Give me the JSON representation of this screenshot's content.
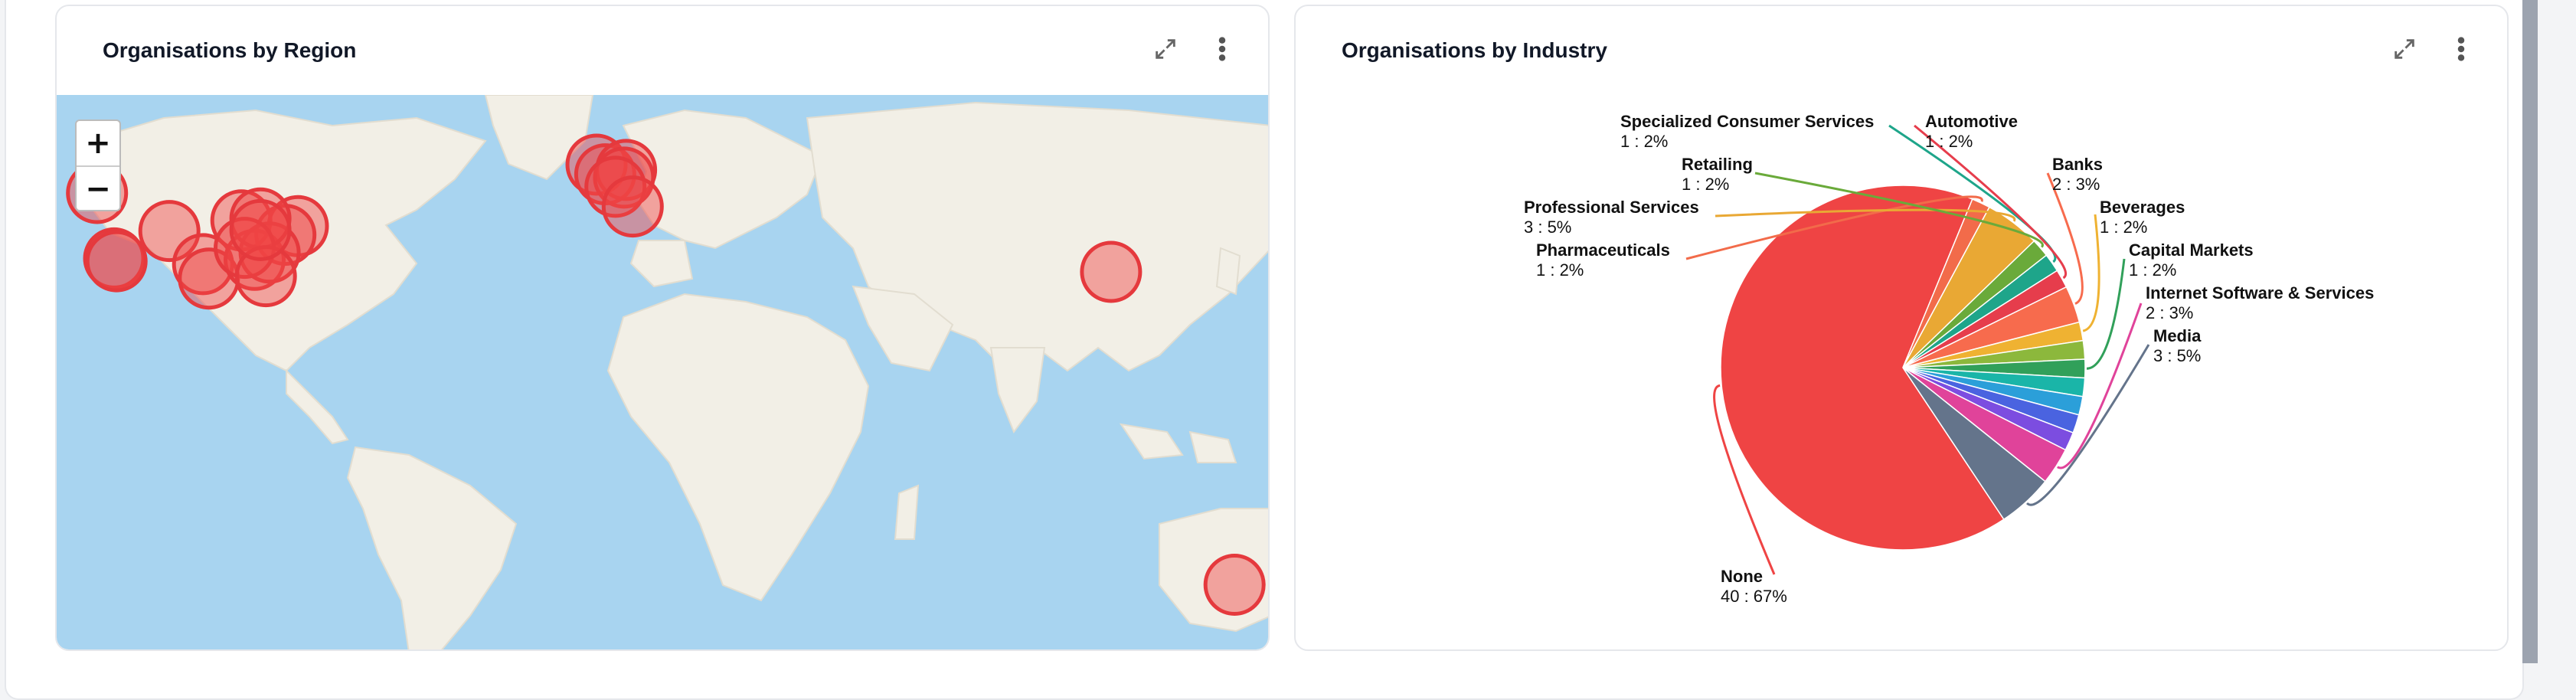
{
  "region_card": {
    "title": "Organisations by Region",
    "zoom_in": "+",
    "zoom_out": "−",
    "markers": [
      {
        "lat": 47.6,
        "lng": -122.3
      },
      {
        "lat": 34.0,
        "lng": -118.2
      },
      {
        "lat": 33.4,
        "lng": -117.6
      },
      {
        "lat": 41.9,
        "lng": -87.6
      },
      {
        "lat": 39.7,
        "lng": -104.9
      },
      {
        "lat": 32.8,
        "lng": -96.8
      },
      {
        "lat": 29.8,
        "lng": -95.4
      },
      {
        "lat": 40.7,
        "lng": -74.0
      },
      {
        "lat": 38.9,
        "lng": -77.0
      },
      {
        "lat": 33.7,
        "lng": -84.4
      },
      {
        "lat": 35.2,
        "lng": -80.8
      },
      {
        "lat": 42.3,
        "lng": -83.0
      },
      {
        "lat": 36.2,
        "lng": -86.8
      },
      {
        "lat": 30.3,
        "lng": -81.7
      },
      {
        "lat": 39.9,
        "lng": -83.0
      },
      {
        "lat": 53.5,
        "lng": -2.2
      },
      {
        "lat": 51.5,
        "lng": -0.1
      },
      {
        "lat": 52.4,
        "lng": 4.9
      },
      {
        "lat": 50.8,
        "lng": 4.4
      },
      {
        "lat": 48.9,
        "lng": 2.35
      },
      {
        "lat": 44.8,
        "lng": 6.5
      },
      {
        "lat": 31.2,
        "lng": 121.5
      },
      {
        "lat": -33.9,
        "lng": 151.2
      }
    ]
  },
  "industry_card": {
    "title": "Organisations by Industry",
    "chart_data": {
      "type": "pie",
      "slices": [
        {
          "name": "None",
          "count": 40,
          "pct": "67%",
          "color": "#ef4444"
        },
        {
          "name": "Pharmaceuticals",
          "count": 1,
          "pct": "2%",
          "color": "#f26b4a"
        },
        {
          "name": "Professional Services",
          "count": 3,
          "pct": "5%",
          "color": "#e9a834"
        },
        {
          "name": "Retailing",
          "count": 1,
          "pct": "2%",
          "color": "#6aaa3a"
        },
        {
          "name": "Specialized Consumer Services",
          "count": 1,
          "pct": "2%",
          "color": "#1ea58a"
        },
        {
          "name": "Automotive",
          "count": 1,
          "pct": "2%",
          "color": "#e63d4c"
        },
        {
          "name": "Banks",
          "count": 2,
          "pct": "3%",
          "color": "#f76b4d"
        },
        {
          "name": "Beverages",
          "count": 1,
          "pct": "2%",
          "color": "#efb232"
        },
        {
          "name": "Beverages",
          "count": 1,
          "pct": "2%",
          "color": "#8cb83c"
        },
        {
          "name": "Capital Markets",
          "count": 1,
          "pct": "2%",
          "color": "#31a05a"
        },
        {
          "name": "",
          "count": 1,
          "pct": "2%",
          "color": "#1ab5a8"
        },
        {
          "name": "",
          "count": 1,
          "pct": "2%",
          "color": "#2b9fd9"
        },
        {
          "name": "",
          "count": 1,
          "pct": "2%",
          "color": "#4a63e0"
        },
        {
          "name": "",
          "count": 1,
          "pct": "2%",
          "color": "#7c4de0"
        },
        {
          "name": "Internet Software & Services",
          "count": 2,
          "pct": "3%",
          "color": "#e0439a"
        },
        {
          "name": "Media",
          "count": 3,
          "pct": "5%",
          "color": "#64748b"
        }
      ]
    }
  }
}
